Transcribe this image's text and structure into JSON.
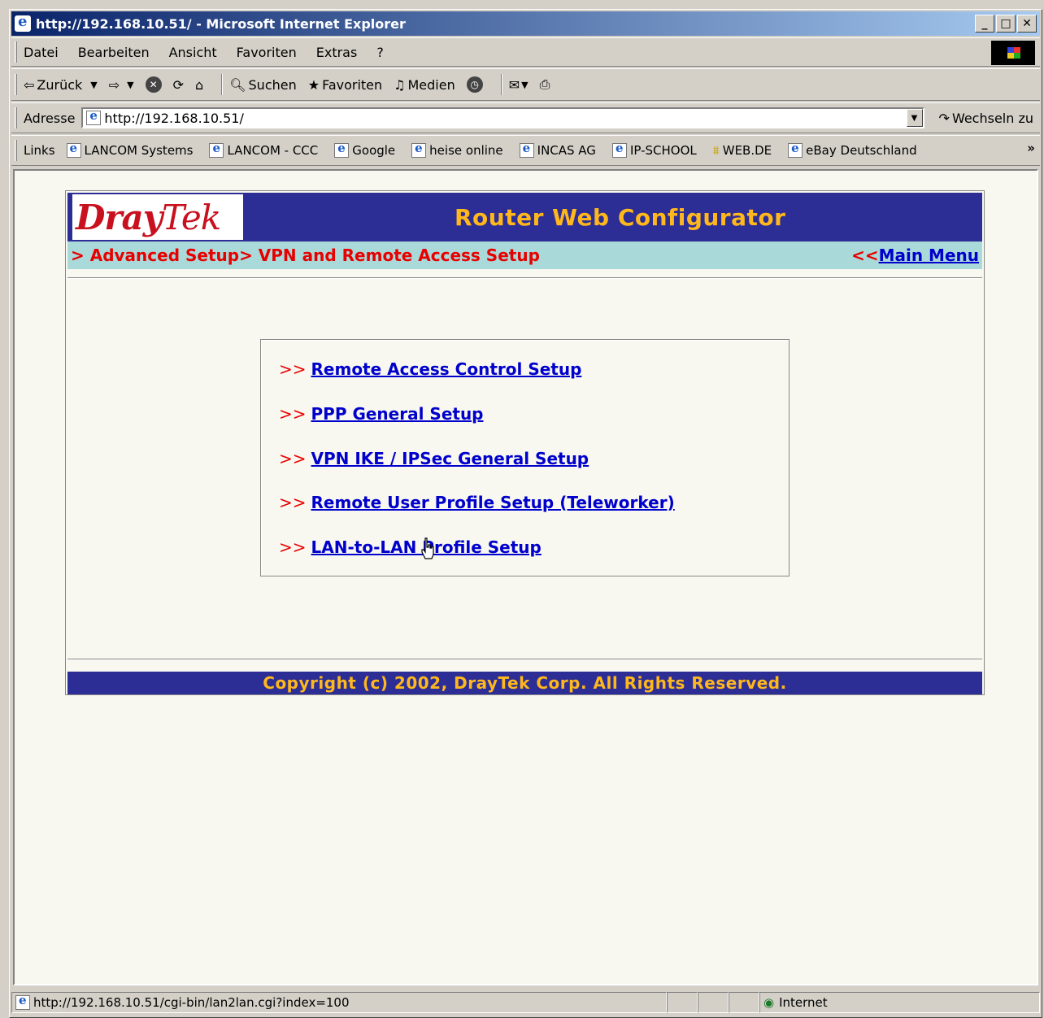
{
  "window": {
    "title": "http://192.168.10.51/ - Microsoft Internet Explorer"
  },
  "menubar": {
    "items": [
      "Datei",
      "Bearbeiten",
      "Ansicht",
      "Favoriten",
      "Extras",
      "?"
    ]
  },
  "toolbar": {
    "back": "Zurück",
    "search": "Suchen",
    "favorites": "Favoriten",
    "media": "Medien"
  },
  "address": {
    "label": "Adresse",
    "url": "http://192.168.10.51/",
    "go": "Wechseln zu"
  },
  "links": {
    "label": "Links",
    "items": [
      "LANCOM Systems",
      "LANCOM - CCC",
      "Google",
      "heise online",
      "INCAS AG",
      "IP-SCHOOL",
      "WEB.DE",
      "eBay Deutschland"
    ]
  },
  "page": {
    "logo_part1": "Dray",
    "logo_part2": "Tek",
    "header_title": "Router Web Configurator",
    "breadcrumb": "> Advanced Setup> VPN and Remote Access Setup",
    "main_menu_prefix": "<<",
    "main_menu_label": "Main Menu",
    "menu_arrow": ">>",
    "menu": [
      "Remote Access Control Setup",
      "PPP General Setup",
      "VPN IKE / IPSec General Setup",
      "Remote User Profile Setup (Teleworker)",
      "LAN-to-LAN Profile Setup"
    ],
    "footer": "Copyright (c) 2002, DrayTek Corp. All Rights Reserved."
  },
  "status": {
    "url": "http://192.168.10.51/cgi-bin/lan2lan.cgi?index=100",
    "zone": "Internet"
  }
}
